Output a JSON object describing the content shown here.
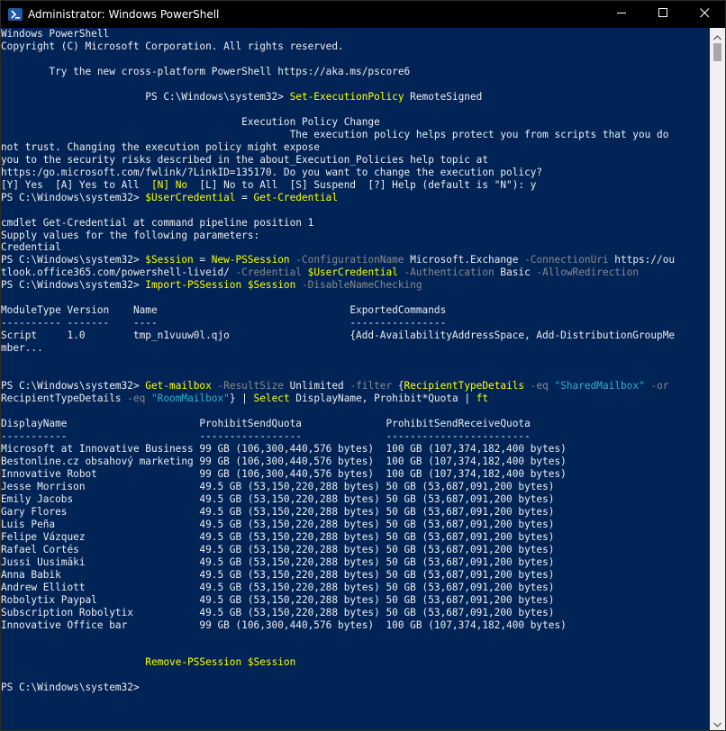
{
  "window": {
    "title": "Administrator: Windows PowerShell",
    "icon": "powershell-icon",
    "controls": {
      "minimize": "minimize-icon",
      "maximize": "maximize-icon",
      "close": "close-icon"
    }
  },
  "colors": {
    "background": "#012456",
    "text": "#eeedf0",
    "command": "#ffff00",
    "parameter": "#8a8a8a",
    "variable": "#ffff00",
    "string": "#31b0c7"
  },
  "console": {
    "lines": [
      [
        [
          "Windows PowerShell",
          "w"
        ]
      ],
      [
        [
          "Copyright (C) Microsoft Corporation. All rights reserved.",
          "w"
        ]
      ],
      [
        [
          "",
          "w"
        ]
      ],
      [
        [
          "        Try the new cross-platform PowerShell https://aka.ms/pscore6",
          "w"
        ]
      ],
      [
        [
          "",
          "w"
        ]
      ],
      [
        [
          "                        PS C:\\Windows\\system32> ",
          "w"
        ],
        [
          "Set-ExecutionPolicy",
          "y"
        ],
        [
          " RemoteSigned",
          "w"
        ]
      ],
      [
        [
          "",
          "w"
        ]
      ],
      [
        [
          "                                        Execution Policy Change",
          "w"
        ]
      ],
      [
        [
          "                                                The execution policy helps protect you from scripts that you do",
          "w"
        ]
      ],
      [
        [
          "not trust. Changing the execution policy might expose",
          "w"
        ]
      ],
      [
        [
          "you to the security risks described in the about_Execution_Policies help topic at",
          "w"
        ]
      ],
      [
        [
          "https:/go.microsoft.com/fwlink/?LinkID=135170. Do you want to change the execution policy?",
          "w"
        ]
      ],
      [
        [
          "[Y] Yes  [A] Yes to All  ",
          "w"
        ],
        [
          "[N] No",
          "y"
        ],
        [
          "  [L] No to All  [S] Suspend  [?] Help (default is \"N\"): y",
          "w"
        ]
      ],
      [
        [
          "PS C:\\Windows\\system32> ",
          "w"
        ],
        [
          "$UserCredential",
          "y"
        ],
        [
          " = ",
          "w"
        ],
        [
          "Get-Credential",
          "y"
        ]
      ],
      [
        [
          "",
          "w"
        ]
      ],
      [
        [
          "cmdlet Get-Credential at command pipeline position 1",
          "w"
        ]
      ],
      [
        [
          "Supply values for the following parameters:",
          "w"
        ]
      ],
      [
        [
          "Credential",
          "w"
        ]
      ],
      [
        [
          "PS C:\\Windows\\system32> ",
          "w"
        ],
        [
          "$Session",
          "y"
        ],
        [
          " = ",
          "w"
        ],
        [
          "New-PSSession",
          "y"
        ],
        [
          " -ConfigurationName",
          "g"
        ],
        [
          " Microsoft.Exchange",
          "w"
        ],
        [
          " -ConnectionUri",
          "g"
        ],
        [
          " https://ou",
          "w"
        ]
      ],
      [
        [
          "tlook.office365.com/powershell-liveid/",
          "w"
        ],
        [
          " -Credential",
          "g"
        ],
        [
          " $UserCredential",
          "y"
        ],
        [
          " -Authentication",
          "g"
        ],
        [
          " Basic",
          "w"
        ],
        [
          " -AllowRedirection",
          "g"
        ]
      ],
      [
        [
          "PS C:\\Windows\\system32> ",
          "w"
        ],
        [
          "Import-PSSession",
          "y"
        ],
        [
          " $Session",
          "y"
        ],
        [
          " -DisableNameChecking",
          "g"
        ]
      ],
      [
        [
          "",
          "w"
        ]
      ],
      [
        [
          "ModuleType Version    Name                                ExportedCommands",
          "w"
        ]
      ],
      [
        [
          "---------- -------    ----                                ----------------",
          "w"
        ]
      ],
      [
        [
          "Script     1.0        tmp_n1vuuw0l.qjo                    {Add-AvailabilityAddressSpace, Add-DistributionGroupMe",
          "w"
        ]
      ],
      [
        [
          "mber...",
          "w"
        ]
      ],
      [
        [
          "",
          "w"
        ]
      ],
      [
        [
          "",
          "w"
        ]
      ],
      [
        [
          "PS C:\\Windows\\system32> ",
          "w"
        ],
        [
          "Get-mailbox",
          "y"
        ],
        [
          " -ResultSize",
          "g"
        ],
        [
          " Unlimited",
          "w"
        ],
        [
          " -filter",
          "g"
        ],
        [
          " {",
          "w"
        ],
        [
          "RecipientTypeDetails",
          "y"
        ],
        [
          " -eq",
          "g"
        ],
        [
          " \"SharedMailbox\"",
          "c"
        ],
        [
          " -or",
          "g"
        ]
      ],
      [
        [
          "RecipientTypeDetails",
          "w"
        ],
        [
          " -eq",
          "g"
        ],
        [
          " \"RoomMailbox\"",
          "c"
        ],
        [
          "} | ",
          "w"
        ],
        [
          "Select",
          "y"
        ],
        [
          " DisplayName, Prohibit*Quota | ",
          "w"
        ],
        [
          "ft",
          "y"
        ]
      ],
      [
        [
          "",
          "w"
        ]
      ],
      [
        [
          "DisplayName                      ProhibitSendQuota              ProhibitSendReceiveQuota",
          "w"
        ]
      ],
      [
        [
          "-----------                      -----------------              ------------------------",
          "w"
        ]
      ],
      [
        [
          "Microsoft at Innovative Business 99 GB (106,300,440,576 bytes)  100 GB (107,374,182,400 bytes)",
          "w"
        ]
      ],
      [
        [
          "Bestonline.cz obsahový marketing 99 GB (106,300,440,576 bytes)  100 GB (107,374,182,400 bytes)",
          "w"
        ]
      ],
      [
        [
          "Innovative Robot                 99 GB (106,300,440,576 bytes)  100 GB (107,374,182,400 bytes)",
          "w"
        ]
      ],
      [
        [
          "Jesse Morrison                   49.5 GB (53,150,220,288 bytes) 50 GB (53,687,091,200 bytes)",
          "w"
        ]
      ],
      [
        [
          "Emily Jacobs                     49.5 GB (53,150,220,288 bytes) 50 GB (53,687,091,200 bytes)",
          "w"
        ]
      ],
      [
        [
          "Gary Flores                      49.5 GB (53,150,220,288 bytes) 50 GB (53,687,091,200 bytes)",
          "w"
        ]
      ],
      [
        [
          "Luis Peña                        49.5 GB (53,150,220,288 bytes) 50 GB (53,687,091,200 bytes)",
          "w"
        ]
      ],
      [
        [
          "Felipe Vázquez                   49.5 GB (53,150,220,288 bytes) 50 GB (53,687,091,200 bytes)",
          "w"
        ]
      ],
      [
        [
          "Rafael Cortés                    49.5 GB (53,150,220,288 bytes) 50 GB (53,687,091,200 bytes)",
          "w"
        ]
      ],
      [
        [
          "Jussi Uusimäki                   49.5 GB (53,150,220,288 bytes) 50 GB (53,687,091,200 bytes)",
          "w"
        ]
      ],
      [
        [
          "Anna Babik                       49.5 GB (53,150,220,288 bytes) 50 GB (53,687,091,200 bytes)",
          "w"
        ]
      ],
      [
        [
          "Andrew Elliott                   49.5 GB (53,150,220,288 bytes) 50 GB (53,687,091,200 bytes)",
          "w"
        ]
      ],
      [
        [
          "Robolytix Paypal                 49.5 GB (53,150,220,288 bytes) 50 GB (53,687,091,200 bytes)",
          "w"
        ]
      ],
      [
        [
          "Subscription Robolytix           49.5 GB (53,150,220,288 bytes) 50 GB (53,687,091,200 bytes)",
          "w"
        ]
      ],
      [
        [
          "Innovative Office bar            99 GB (106,300,440,576 bytes)  100 GB (107,374,182,400 bytes)",
          "w"
        ]
      ],
      [
        [
          "",
          "w"
        ]
      ],
      [
        [
          "",
          "w"
        ]
      ],
      [
        [
          "                        ",
          "w"
        ],
        [
          "Remove-PSSession",
          "y"
        ],
        [
          " $Session",
          "y"
        ]
      ],
      [
        [
          "",
          "w"
        ]
      ],
      [
        [
          "PS C:\\Windows\\system32>",
          "w"
        ]
      ]
    ]
  }
}
